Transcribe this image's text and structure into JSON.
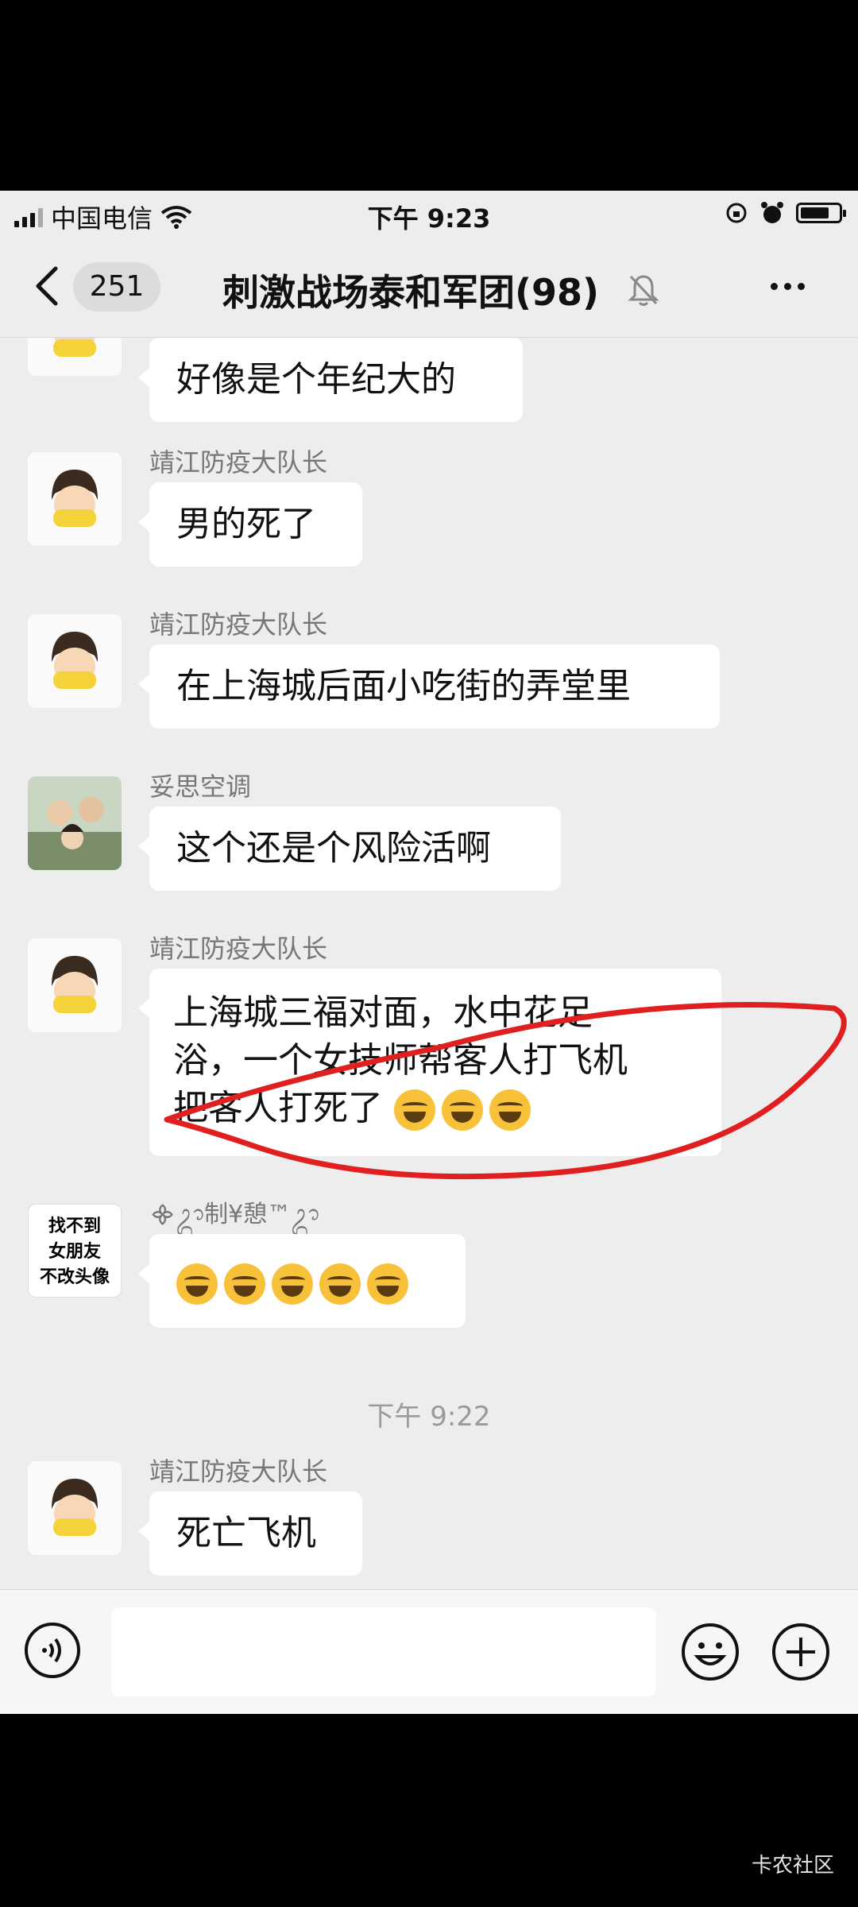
{
  "status_bar": {
    "carrier": "中国电信",
    "time": "下午 9:23"
  },
  "nav": {
    "unread_count": "251",
    "title": "刺激战场泰和军团(98)"
  },
  "messages": [
    {
      "sender": "",
      "text": "好像是个年纪大的"
    },
    {
      "sender": "靖江防疫大队长",
      "text": "男的死了"
    },
    {
      "sender": "靖江防疫大队长",
      "text": "在上海城后面小吃街的弄堂里"
    },
    {
      "sender": "妥思空调",
      "text": "这个还是个风险活啊"
    },
    {
      "sender": "靖江防疫大队长",
      "lines": [
        " 上海城三福对面，水中花足",
        "浴，一个女技师帮客人打飞机",
        "把客人打死了"
      ],
      "emoji_count": 3
    },
    {
      "sender": "᯽ᬊ制¥憩™ᬊ",
      "avatar_text": [
        "找不到",
        "女朋友",
        "不改头像"
      ],
      "emoji_count": 5
    },
    {
      "timestamp": "下午 9:22"
    },
    {
      "sender": "靖江防疫大队长",
      "text": "死亡飞机"
    }
  ],
  "input": {
    "placeholder": ""
  },
  "icons": {
    "back": "chevron-left-icon",
    "mute": "bell-off-icon",
    "more": "more-dots-icon",
    "voice": "voice-icon",
    "emoji": "smiley-icon",
    "plus": "plus-icon",
    "reaction": "tears-of-joy-emoji"
  },
  "colors": {
    "annotation_circle": "#e02020",
    "chat_bg": "#ededed",
    "bubble": "#ffffff"
  },
  "watermark": "卡农社区"
}
